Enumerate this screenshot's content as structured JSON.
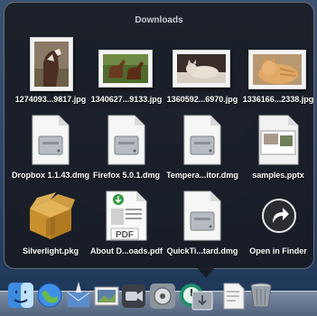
{
  "stack": {
    "title": "Downloads",
    "items": [
      {
        "label": "1274093...9817.jpg",
        "icon": "photo-horse-icon"
      },
      {
        "label": "1340627...9133.jpg",
        "icon": "photo-horses-icon"
      },
      {
        "label": "1360592...6970.jpg",
        "icon": "photo-cat-icon"
      },
      {
        "label": "1336166...2338.jpg",
        "icon": "photo-kitten-icon"
      },
      {
        "label": "Dropbox 1.1.43.dmg",
        "icon": "disk-image-icon"
      },
      {
        "label": "Firefox 5.0.1.dmg",
        "icon": "disk-image-icon"
      },
      {
        "label": "Tempera...itor.dmg",
        "icon": "disk-image-icon"
      },
      {
        "label": "samples.pptx",
        "icon": "presentation-icon"
      },
      {
        "label": "Silverlight.pkg",
        "icon": "package-icon"
      },
      {
        "label": "About D...oads.pdf",
        "icon": "pdf-icon"
      },
      {
        "label": "QuickTi...tard.dmg",
        "icon": "disk-image-icon"
      },
      {
        "label": "Open in Finder",
        "icon": "open-in-finder-icon"
      }
    ]
  },
  "dock": {
    "icons": [
      "finder-icon",
      "network-globe-icon",
      "mail-icon",
      "photo-app-icon",
      "facetime-icon",
      "system-preferences-icon",
      "time-machine-icon",
      "downloads-stack-icon",
      "documents-stack-icon",
      "trash-icon"
    ]
  }
}
